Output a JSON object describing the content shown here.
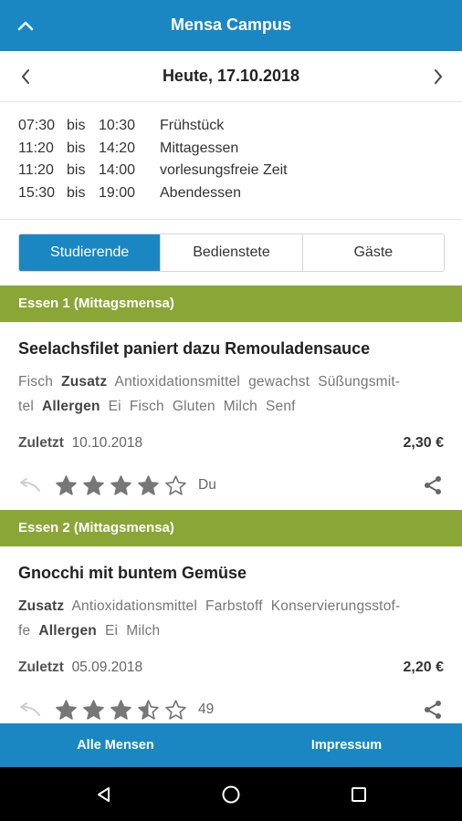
{
  "appbar": {
    "title": "Mensa Campus",
    "up_icon": "chevron-up-icon"
  },
  "datebar": {
    "date": "Heute, 17.10.2018",
    "prev_icon": "chevron-left-icon",
    "next_icon": "chevron-right-icon"
  },
  "hours": [
    {
      "from": "07:30",
      "bis": "bis",
      "to": "10:30",
      "label": "Frühstück"
    },
    {
      "from": "11:20",
      "bis": "bis",
      "to": "14:20",
      "label": "Mittagessen"
    },
    {
      "from": "11:20",
      "bis": "bis",
      "to": "14:00",
      "label": "vorlesungsfreie Zeit"
    },
    {
      "from": "15:30",
      "bis": "bis",
      "to": "19:00",
      "label": "Abendessen"
    }
  ],
  "segments": {
    "items": [
      "Studierende",
      "Bedienstete",
      "Gäste"
    ],
    "selected": "Studierende"
  },
  "meals": [
    {
      "section": "Essen 1 (Mittagsmensa)",
      "name": "Seelachsfilet paniert dazu Remouladensauce",
      "tags_line1": [
        "Fisch",
        "Zusatz",
        "Antioxidationsmittel",
        "gewachst",
        "Süßungsmit-"
      ],
      "tags_line2": [
        "tel",
        "Allergen",
        "Ei",
        "Fisch",
        "Gluten",
        "Milch",
        "Senf"
      ],
      "last_label": "Zuletzt",
      "last_date": "10.10.2018",
      "price": "2,30 €",
      "rating": 4,
      "rating_text": "Du"
    },
    {
      "section": "Essen 2 (Mittagsmensa)",
      "name": "Gnocchi mit buntem Gemüse",
      "tags_line1": [
        "Zusatz",
        "Antioxidationsmittel",
        "Farbstoff",
        "Konservierungsstof-"
      ],
      "tags_line2": [
        "fe",
        "Allergen",
        "Ei",
        "Milch"
      ],
      "last_label": "Zuletzt",
      "last_date": "05.09.2018",
      "price": "2,20 €",
      "rating": 3.5,
      "rating_text": "49"
    }
  ],
  "bottom_nav": {
    "left": "Alle Mensen",
    "right": "Impressum"
  },
  "system_nav": {
    "back_icon": "back-triangle-icon",
    "home_icon": "home-circle-icon",
    "recents_icon": "recents-square-icon"
  },
  "colors": {
    "primary": "#1a87c3",
    "section": "#8aa637",
    "star": "#777777"
  }
}
